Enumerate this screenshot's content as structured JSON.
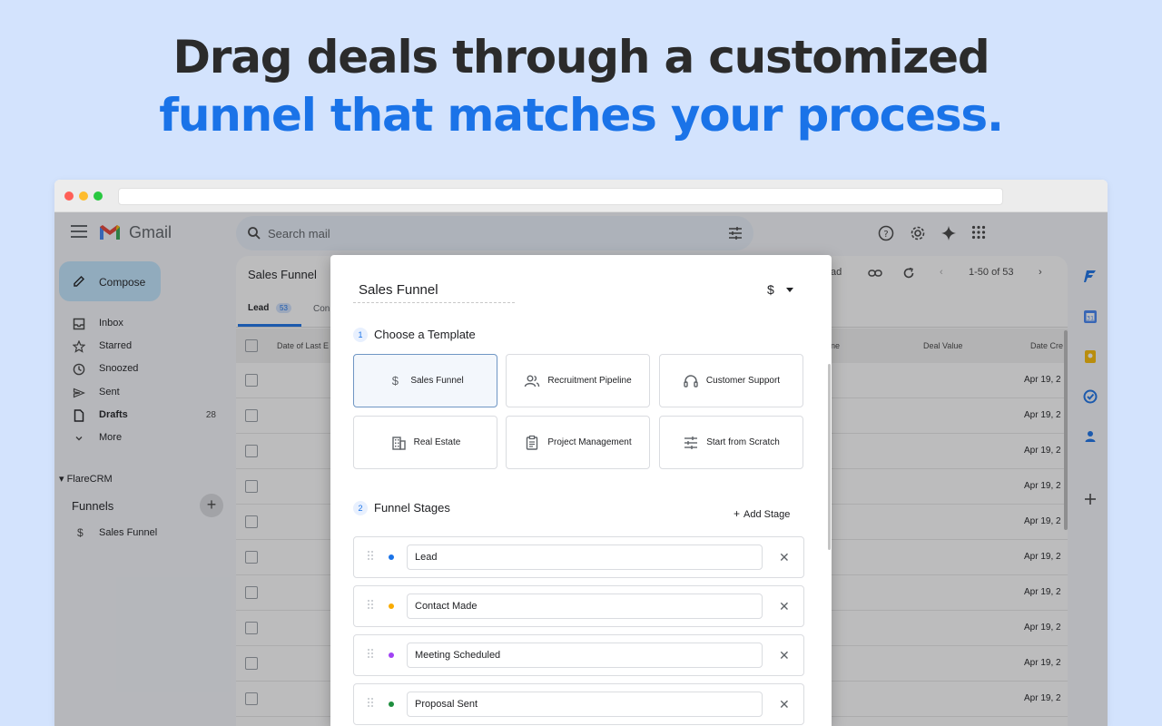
{
  "headline": {
    "line1": "Drag deals through a customized",
    "line2": "funnel that matches your process."
  },
  "gmail": {
    "brand": "Gmail",
    "search_placeholder": "Search mail",
    "compose_label": "Compose",
    "nav": [
      {
        "label": "Inbox",
        "icon": "inbox-icon"
      },
      {
        "label": "Starred",
        "icon": "star-icon"
      },
      {
        "label": "Snoozed",
        "icon": "clock-icon"
      },
      {
        "label": "Sent",
        "icon": "send-icon"
      },
      {
        "label": "Drafts",
        "icon": "draft-icon",
        "count": "28",
        "bold": true
      },
      {
        "label": "More",
        "icon": "chevron-down-icon"
      }
    ],
    "crm_section": "FlareCRM",
    "funnels_label": "Funnels",
    "funnel_item": "Sales Funnel",
    "main_title": "Sales Funnel",
    "toolbar_partial": "ad",
    "pagination": "1-50 of 53",
    "tabs": {
      "lead": "Lead",
      "lead_count": "53",
      "next_partial": "Con"
    },
    "columns": {
      "date_last": "Date of Last E",
      "partial": "ne",
      "deal_value": "Deal Value",
      "date_created": "Date Cre"
    },
    "rows": [
      "Apr 19, 2",
      "Apr 19, 2",
      "Apr 19, 2",
      "Apr 19, 2",
      "Apr 19, 2",
      "Apr 19, 2",
      "Apr 19, 2",
      "Apr 19, 2",
      "Apr 19, 2",
      "Apr 19, 2"
    ]
  },
  "modal": {
    "title": "Sales Funnel",
    "currency": "$",
    "step1": {
      "num": "1",
      "label": "Choose a Template"
    },
    "templates": [
      {
        "label": "Sales Funnel",
        "icon": "dollar-icon",
        "selected": true
      },
      {
        "label": "Recruitment Pipeline",
        "icon": "people-icon"
      },
      {
        "label": "Customer Support",
        "icon": "headset-icon"
      },
      {
        "label": "Real Estate",
        "icon": "building-icon"
      },
      {
        "label": "Project Management",
        "icon": "clipboard-icon"
      },
      {
        "label": "Start from Scratch",
        "icon": "sliders-icon"
      }
    ],
    "step2": {
      "num": "2",
      "label": "Funnel Stages"
    },
    "add_stage": "Add Stage",
    "stages": [
      {
        "name": "Lead",
        "color": "#1a73e8"
      },
      {
        "name": "Contact Made",
        "color": "#f9ab00"
      },
      {
        "name": "Meeting Scheduled",
        "color": "#a142f4"
      },
      {
        "name": "Proposal Sent",
        "color": "#1e8e3e"
      }
    ]
  },
  "colors": {
    "accent": "#1a73e8",
    "page_bg": "#d3e3fd"
  }
}
